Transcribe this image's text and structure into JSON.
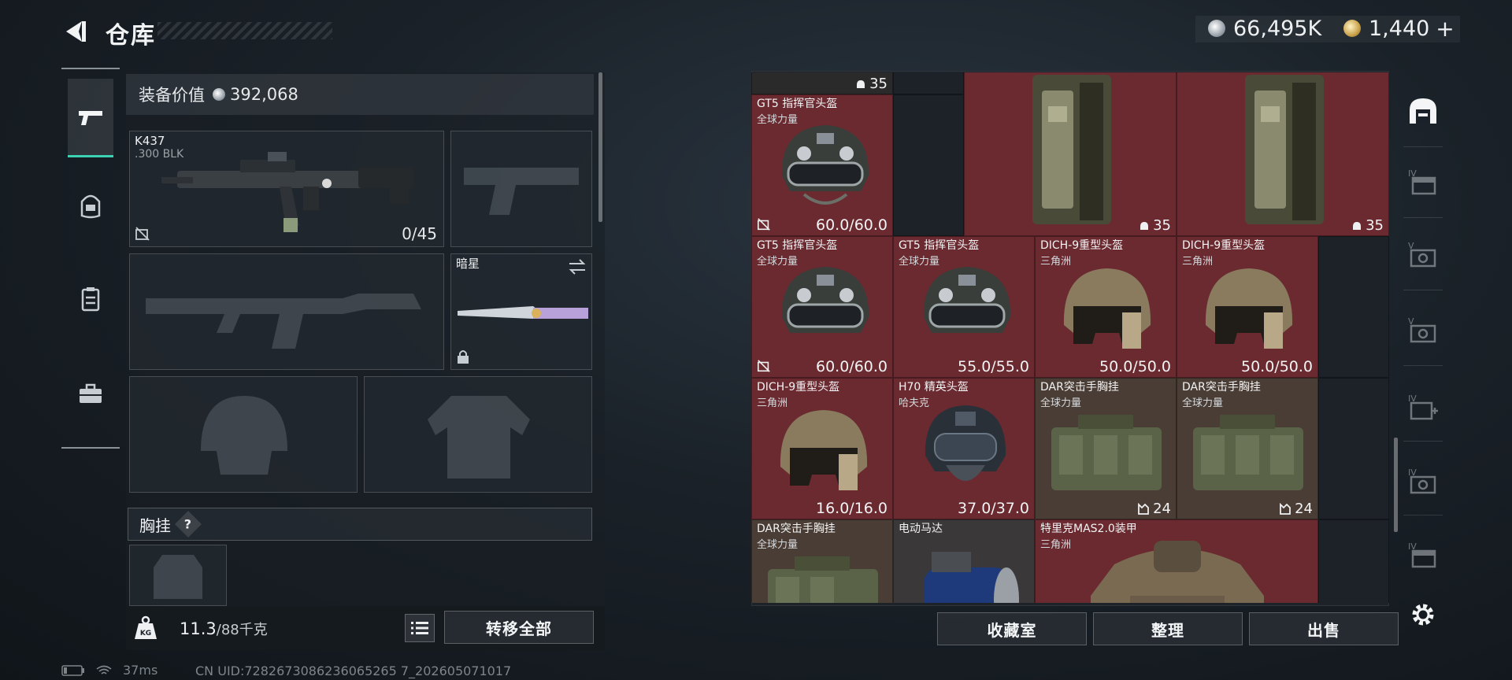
{
  "header": {
    "title": "仓库",
    "silver_amount": "66,495K",
    "gold_amount": "1,440",
    "gold_add": "+"
  },
  "left": {
    "value_label": "装备价值",
    "value_amount": "392,068",
    "nav": [
      "primary-weapon",
      "backpack",
      "vest",
      "case"
    ],
    "slots": {
      "primary": {
        "name": "K437",
        "ammo": ".300 BLK",
        "count": "0/45"
      },
      "melee": {
        "name": "暗星"
      }
    },
    "section_chest": "胸挂",
    "section_help": "?",
    "weight_current": "11.3",
    "weight_max": "/88千克",
    "transfer_all": "转移全部"
  },
  "grid": {
    "items": [
      {
        "name": "",
        "sub": "",
        "tag": "35"
      },
      {
        "name": "GT5 指挥官头盔",
        "sub": "全球力量",
        "dur": "60.0/60.0"
      },
      {
        "name": "",
        "sub": "",
        "tag": "35"
      },
      {
        "name": "",
        "sub": "",
        "tag": "35"
      },
      {
        "name": "GT5 指挥官头盔",
        "sub": "全球力量",
        "dur": "60.0/60.0"
      },
      {
        "name": "GT5 指挥官头盔",
        "sub": "全球力量",
        "dur": "55.0/55.0"
      },
      {
        "name": "DICH-9重型头盔",
        "sub": "三角洲",
        "dur": "50.0/50.0"
      },
      {
        "name": "DICH-9重型头盔",
        "sub": "三角洲",
        "dur": "50.0/50.0"
      },
      {
        "name": "DICH-9重型头盔",
        "sub": "三角洲",
        "dur": "16.0/16.0"
      },
      {
        "name": "H70 精英头盔",
        "sub": "哈夫克",
        "dur": "37.0/37.0"
      },
      {
        "name": "DAR突击手胸挂",
        "sub": "全球力量",
        "tag": "24"
      },
      {
        "name": "DAR突击手胸挂",
        "sub": "全球力量",
        "tag": "24"
      },
      {
        "name": "DAR突击手胸挂",
        "sub": "全球力量"
      },
      {
        "name": "电动马达",
        "sub": ""
      },
      {
        "name": "特里克MAS2.0装甲",
        "sub": "三角洲"
      }
    ]
  },
  "actions": {
    "collection": "收藏室",
    "organize": "整理",
    "sell": "出售"
  },
  "status": {
    "ping": "37ms",
    "uid": "CN UID:7282673086236065265 7_202605071017"
  },
  "colors": {
    "accent": "#3bd1b2",
    "rare_red": "#6a2a30",
    "brown": "#4a3d35"
  }
}
